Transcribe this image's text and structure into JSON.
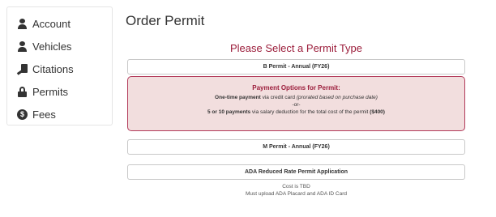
{
  "sidebar": {
    "items": [
      {
        "label": "Account",
        "icon": "user-icon"
      },
      {
        "label": "Vehicles",
        "icon": "user-icon"
      },
      {
        "label": "Citations",
        "icon": "citation-icon"
      },
      {
        "label": "Permits",
        "icon": "lock-icon"
      },
      {
        "label": "Fees",
        "icon": "coin-icon"
      }
    ]
  },
  "main": {
    "title": "Order Permit",
    "heading": "Please Select a Permit Type",
    "permits": {
      "b_permit": "B Permit - Annual (FY26)",
      "m_permit": "M Permit - Annual (FY26)",
      "ada_permit": "ADA Reduced Rate Permit Application"
    },
    "payment": {
      "title": "Payment Options for Permit:",
      "option1_bold": "One-time payment",
      "option1_text": " via credit card ",
      "option1_italic": "(prorated based on purchase date)",
      "or": "-or-",
      "option2_bold": "5 or 10 payments",
      "option2_text": " via salary deduction for the total cost of the permit ",
      "option2_amount": "($400)"
    },
    "ada_note": {
      "line1": "Cost is TBD",
      "line2": "Must upload ADA Placard and ADA ID Card"
    }
  },
  "colors": {
    "accent": "#9b1c3a",
    "alert_bg": "#f2dede",
    "alert_border": "#b23a5a"
  }
}
